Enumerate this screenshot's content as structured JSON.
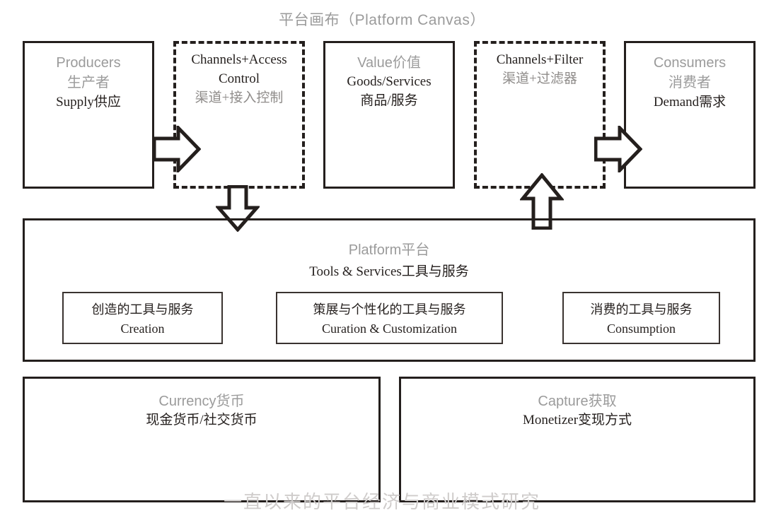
{
  "title": "平台画布（Platform Canvas）",
  "top_row": [
    {
      "name": "producers",
      "style": "solid",
      "lines": [
        {
          "text": "Producers",
          "style": "gray-sans",
          "size": "lg"
        },
        {
          "text": "生产者",
          "style": "gray-sans",
          "size": "lg"
        },
        {
          "text": "Supply供应",
          "style": "dark-serif",
          "size": "md"
        }
      ]
    },
    {
      "name": "channels-access-control",
      "style": "dashed",
      "lines": [
        {
          "text": "Channels+Access",
          "style": "dark-serif",
          "size": "md"
        },
        {
          "text": "Control",
          "style": "dark-serif",
          "size": "md"
        },
        {
          "text": "渠道+接入控制",
          "style": "gray-serif",
          "size": "md"
        }
      ]
    },
    {
      "name": "value",
      "style": "solid",
      "lines": [
        {
          "text": "Value价值",
          "style": "gray-sans",
          "size": "lg"
        },
        {
          "text": "Goods/Services",
          "style": "dark-serif",
          "size": "md"
        },
        {
          "text": "商品/服务",
          "style": "dark-serif",
          "size": "md"
        }
      ]
    },
    {
      "name": "channels-filter",
      "style": "dashed",
      "lines": [
        {
          "text": "Channels+Filter",
          "style": "dark-serif",
          "size": "md"
        },
        {
          "text": "渠道+过滤器",
          "style": "gray-serif",
          "size": "md"
        }
      ]
    },
    {
      "name": "consumers",
      "style": "solid",
      "lines": [
        {
          "text": "Consumers",
          "style": "gray-sans",
          "size": "lg"
        },
        {
          "text": "消费者",
          "style": "gray-sans",
          "size": "lg"
        },
        {
          "text": "Demand需求",
          "style": "dark-serif",
          "size": "md"
        }
      ]
    }
  ],
  "platform": {
    "heading_cn": "Platform平台",
    "heading_en": "Tools & Services工具与服务",
    "subboxes": [
      {
        "cn": "创造的工具与服务",
        "en": "Creation"
      },
      {
        "cn": "策展与个性化的工具与服务",
        "en": "Curation & Customization"
      },
      {
        "cn": "消费的工具与服务",
        "en": "Consumption"
      }
    ]
  },
  "bottom_row": [
    {
      "name": "currency",
      "heading": "Currency货币",
      "detail": "现金货币/社交货币"
    },
    {
      "name": "capture",
      "heading": "Capture获取",
      "detail": "Monetizer变现方式"
    }
  ],
  "arrows": [
    {
      "name": "producers-to-channels-access",
      "direction": "right"
    },
    {
      "name": "channels-access-to-platform",
      "direction": "down"
    },
    {
      "name": "platform-to-channels-filter",
      "direction": "up"
    },
    {
      "name": "channels-filter-to-consumers",
      "direction": "right"
    }
  ],
  "colors": {
    "stroke": "#241f1d",
    "gray_text": "#9b9b9b",
    "gray_serif_text": "#8f8c8a",
    "dark_text": "#241f1d",
    "background": "#ffffff"
  },
  "watermark": "一直以来的平台经济与商业模式研究"
}
